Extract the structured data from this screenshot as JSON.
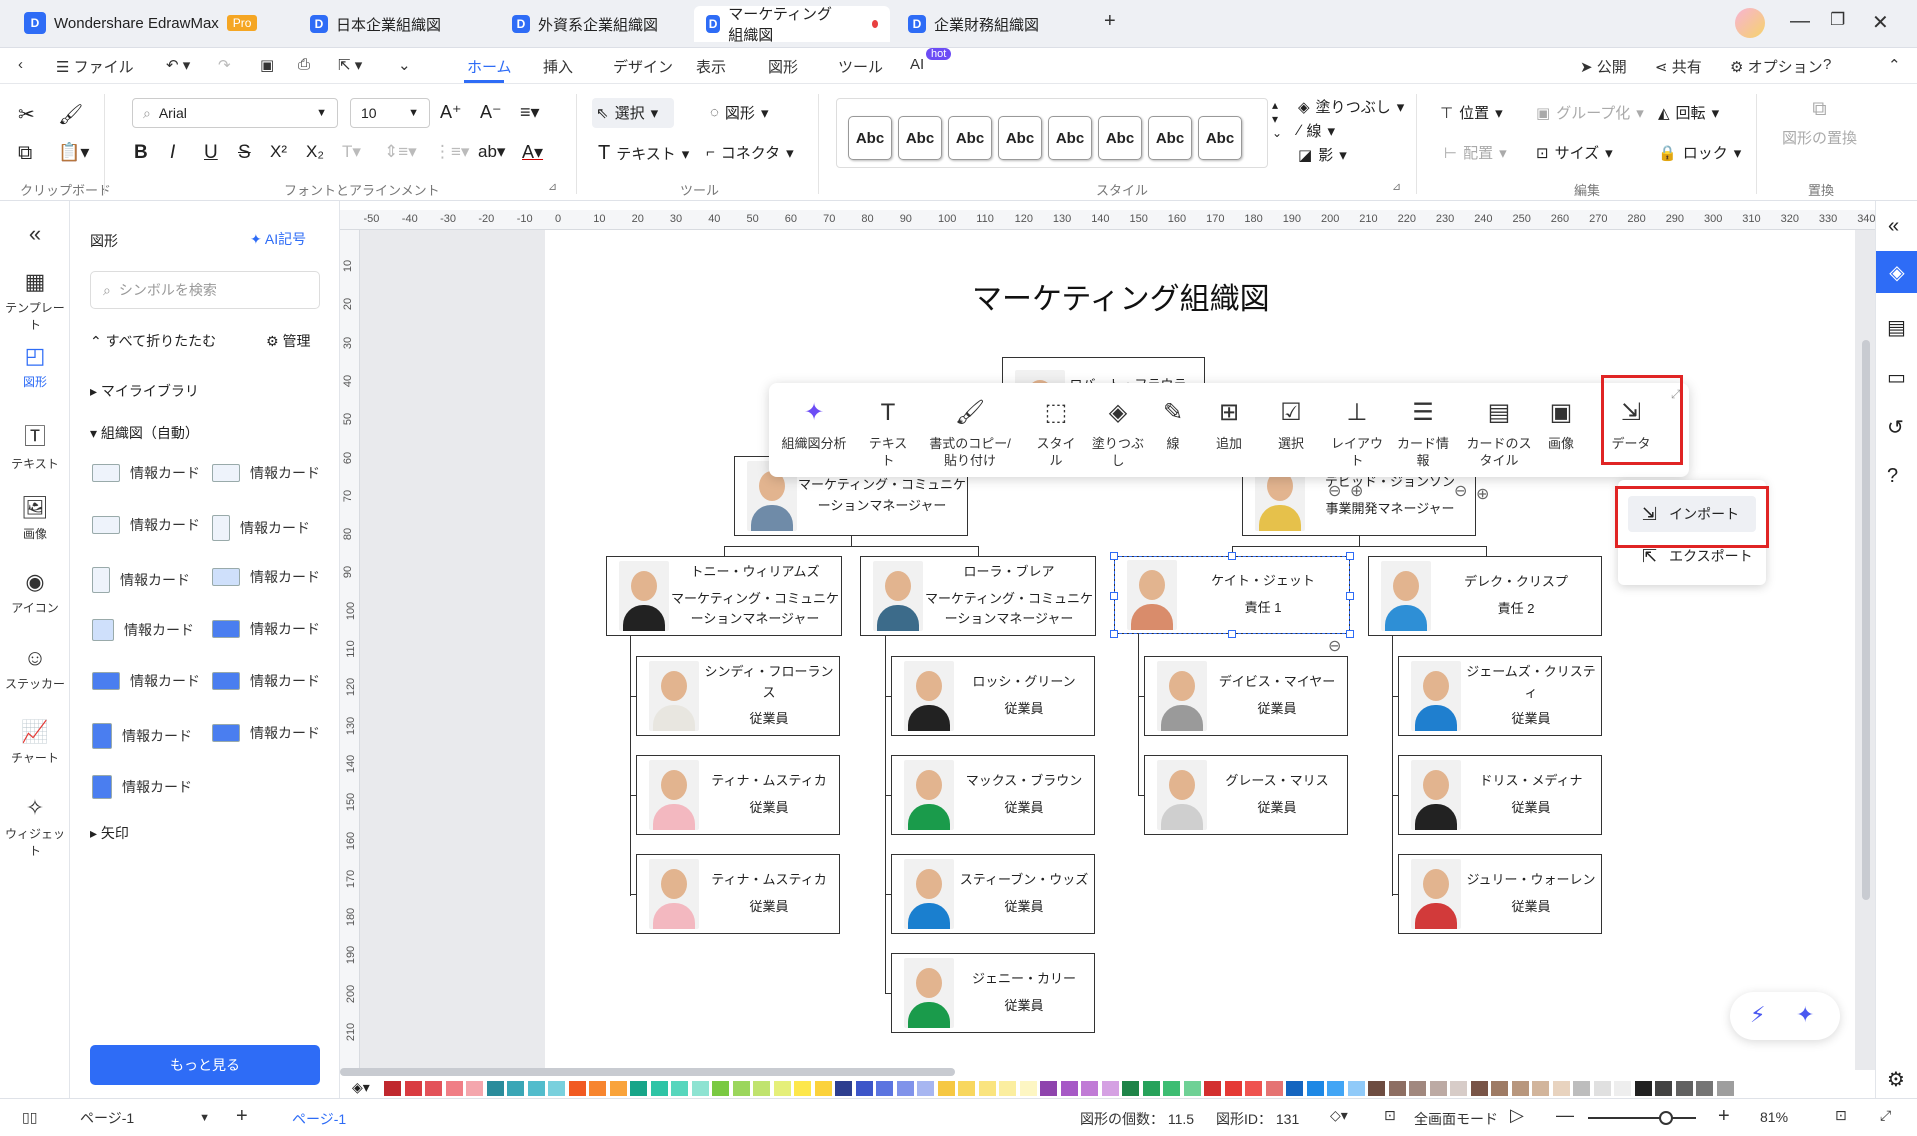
{
  "app": {
    "name": "Wondershare EdrawMax",
    "badge": "Pro"
  },
  "tabs": [
    {
      "label": "日本企業組織図"
    },
    {
      "label": "外資系企業組織図"
    },
    {
      "label": "マーケティング組織図"
    },
    {
      "label": "企業財務組織図"
    }
  ],
  "menu": {
    "file": "ファイル",
    "items": [
      "ホーム",
      "挿入",
      "デザイン",
      "表示",
      "図形",
      "ツール",
      "AI"
    ],
    "ai_badge": "hot",
    "publish": "公開",
    "share": "共有",
    "options": "オプション"
  },
  "ribbon": {
    "font": "Arial",
    "size": "10",
    "select": "選択",
    "shape": "図形",
    "text": "テキスト",
    "connector": "コネクタ",
    "fill": "塗りつぶし",
    "line": "線",
    "shadow": "影",
    "position": "位置",
    "group": "グループ化",
    "rotate": "回転",
    "align": "配置",
    "size_btn": "サイズ",
    "lock": "ロック",
    "replace": "図形の置換",
    "style_sample": "Abc",
    "groups": [
      "クリップボード",
      "フォントとアラインメント",
      "ツール",
      "スタイル",
      "編集",
      "置換"
    ]
  },
  "left": {
    "items": [
      "テンプレート",
      "図形",
      "テキスト",
      "画像",
      "アイコン",
      "ステッカー",
      "チャート",
      "ウィジェット"
    ]
  },
  "panel": {
    "title": "図形",
    "ai_symbol": "AI記号",
    "search_placeholder": "シンボルを検索",
    "collapse": "すべて折りたたむ",
    "manage": "管理",
    "my_library": "マイライブラリ",
    "org_auto": "組織図（自動）",
    "card_label": "情報カード",
    "arrow": "矢印",
    "more": "もっと見る"
  },
  "diagram": {
    "title": "マーケティング組織図",
    "nodes": {
      "root": {
        "name": "ロバート・フラウラー"
      },
      "mcm": {
        "title": "マーケティング・コミュニケーションマネージャー"
      },
      "bd": {
        "name": "デビッド・ジョンソン",
        "title": "事業開発マネージャー"
      },
      "tony": {
        "name": "トニー・ウィリアムズ",
        "title": "マーケティング・コミュニケーションマネージャー"
      },
      "laura": {
        "name": "ローラ・ブレア",
        "title": "マーケティング・コミュニケーションマネージャー"
      },
      "kate": {
        "name": "ケイト・ジェット",
        "title": "責任 1"
      },
      "derek": {
        "name": "デレク・クリスプ",
        "title": "責任 2"
      },
      "cindy": {
        "name": "シンディ・フローランス",
        "title": "従業員"
      },
      "tina1": {
        "name": "ティナ・ムスティカ",
        "title": "従業員"
      },
      "tina2": {
        "name": "ティナ・ムスティカ",
        "title": "従業員"
      },
      "rossi": {
        "name": "ロッシ・グリーン",
        "title": "従業員"
      },
      "max": {
        "name": "マックス・ブラウン",
        "title": "従業員"
      },
      "steven": {
        "name": "スティーブン・ウッズ",
        "title": "従業員"
      },
      "jenny": {
        "name": "ジェニー・カリー",
        "title": "従業員"
      },
      "davis": {
        "name": "デイビス・マイヤー",
        "title": "従業員"
      },
      "grace": {
        "name": "グレース・マリス",
        "title": "従業員"
      },
      "james": {
        "name": "ジェームズ・クリスティ",
        "title": "従業員"
      },
      "doris": {
        "name": "ドリス・メディナ",
        "title": "従業員"
      },
      "julie": {
        "name": "ジュリー・ウォーレン",
        "title": "従業員"
      }
    }
  },
  "float_toolbar": [
    "組織図分析",
    "テキスト",
    "書式のコピー/貼り付け",
    "スタイル",
    "塗りつぶし",
    "線",
    "追加",
    "選択",
    "レイアウト",
    "カード情報",
    "カードのスタイル",
    "画像",
    "データ"
  ],
  "dropdown": {
    "import": "インポート",
    "export": "エクスポート"
  },
  "status": {
    "page_selector": "ページ-1",
    "page_tab": "ページ-1",
    "shape_count": "図形の個数：  11.5",
    "shape_id": "図形ID：  131",
    "fullscreen": "全画面モード",
    "zoom": "81%"
  },
  "palette": [
    "#c0282e",
    "#d93b41",
    "#e3525a",
    "#f07e86",
    "#f4a6ad",
    "#2a8c9c",
    "#3aa6b6",
    "#52bccc",
    "#79d0dd",
    "#f15a22",
    "#f7852f",
    "#f9a33b",
    "#17a589",
    "#2ec4a6",
    "#57d6bd",
    "#8ee3d2",
    "#7ac943",
    "#9bd65d",
    "#c0e36f",
    "#e5ef7a",
    "#fde74c",
    "#fbd23c",
    "#2d3e8f",
    "#3c55c9",
    "#5b74e0",
    "#8093ea",
    "#a7b6f1",
    "#f6c844",
    "#f8d75f",
    "#fae47f",
    "#fbeea0",
    "#fdf6c3",
    "#8e44ad",
    "#a659c6",
    "#c07bd6",
    "#d5a1e3",
    "#1e8449",
    "#27a25b",
    "#3dbd73",
    "#6fd196",
    "#d32f2f",
    "#e53935",
    "#ef5350",
    "#e57373",
    "#1565c0",
    "#1e88e5",
    "#42a5f5",
    "#90caf9",
    "#6d4c41",
    "#8d6e63",
    "#a1887f",
    "#bcaaa4",
    "#d7ccc8",
    "#795548",
    "#9e7b65",
    "#b8977e",
    "#d2b59c",
    "#e8d3bf",
    "#bdbdbd",
    "#e0e0e0",
    "#eeeeee",
    "#212121",
    "#424242",
    "#616161",
    "#757575",
    "#9e9e9e"
  ]
}
